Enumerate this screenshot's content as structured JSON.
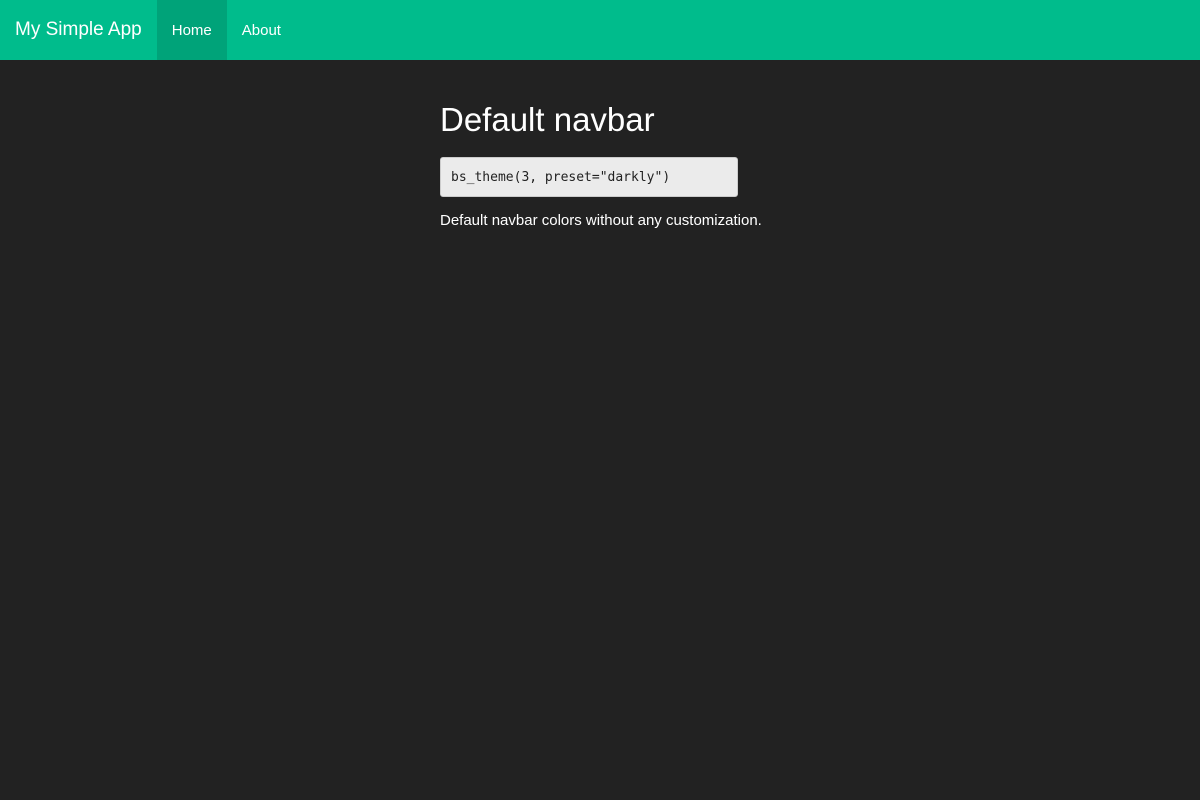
{
  "navbar": {
    "brand": "My Simple App",
    "items": [
      {
        "label": "Home",
        "active": true
      },
      {
        "label": "About",
        "active": false
      }
    ],
    "background_color": "#00bc8c",
    "active_item_color": "#00a379"
  },
  "main": {
    "title": "Default navbar",
    "code": "bs_theme(3, preset=\"darkly\")",
    "description": "Default navbar colors without any customization."
  },
  "page": {
    "background_color": "#222222"
  }
}
